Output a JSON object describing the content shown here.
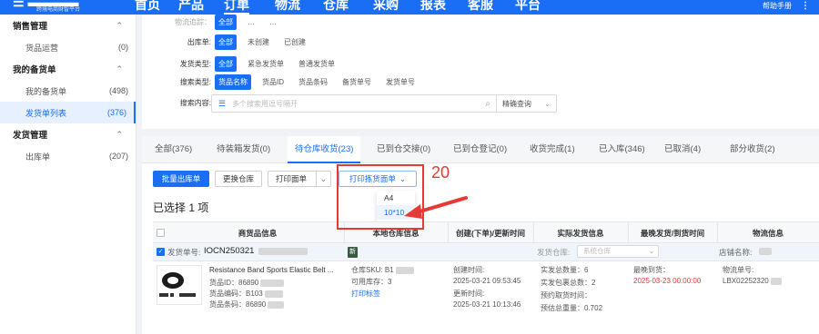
{
  "nav": {
    "logo": "",
    "logo_sub": "跨境电商财智平台",
    "items": [
      "首页",
      "产品",
      "订单",
      "物流",
      "仓库",
      "采购",
      "报表",
      "客服",
      "平台"
    ],
    "active_index": 2,
    "right_text": "帮助手册",
    "more_icon": "menu-dots-icon"
  },
  "sidebar": {
    "groups": [
      {
        "label": "销售管理",
        "items": [
          {
            "label": "货品运营",
            "count": "(0)"
          }
        ]
      },
      {
        "label": "我的备货单",
        "items": [
          {
            "label": "我的备货单",
            "count": "(498)"
          },
          {
            "label": "发货单列表",
            "count": "(376)",
            "active": true
          }
        ]
      },
      {
        "label": "发货管理",
        "items": [
          {
            "label": "出库单",
            "count": "(207)"
          }
        ]
      }
    ]
  },
  "filters": {
    "row0_label": "物流追踪：",
    "row0_chips": [
      "全部",
      "…",
      "…"
    ],
    "outbound_label": "出库单:",
    "outbound_chips": [
      "全部",
      "未创建",
      "已创建"
    ],
    "ship_type_label": "发货类型:",
    "ship_type_chips": [
      "全部",
      "紧急发货单",
      "普通发货单"
    ],
    "search_type_label": "搜索类型:",
    "search_type_chips": [
      "货品名称",
      "货品ID",
      "货品条码",
      "备货单号",
      "发货单号"
    ],
    "content_label": "搜索内容:",
    "search_placeholder": "多个搜索用逗号隔开",
    "search_mode": "精确查询"
  },
  "tabs": [
    {
      "label": "全部(376)"
    },
    {
      "label": "待装箱发货(0)"
    },
    {
      "label": "待仓库收货(23)",
      "active": true
    },
    {
      "label": "已到仓交接(0)"
    },
    {
      "label": "已到仓登记(0)"
    },
    {
      "label": "收货完成(1)"
    },
    {
      "label": "已入库(346)"
    },
    {
      "label": "已取消(4)"
    },
    {
      "label": "部分收货(2)"
    }
  ],
  "toolbar": {
    "batch_outbound": "批量出库单",
    "change_warehouse": "更换仓库",
    "print_sheet": "打印面单",
    "print_pick": "打印拣货面单"
  },
  "dropdown": {
    "options": [
      "A4",
      "10*10"
    ],
    "highlighted": 1
  },
  "annotation": {
    "number": "20",
    "color": "#e53935"
  },
  "selected_text": "已选择 1 项",
  "table": {
    "headers": [
      "商货品信息",
      "本地仓库信息",
      "创建(下单)/更新时间",
      "实际发货信息",
      "最晚发货/到货时间",
      "物流信息"
    ],
    "order_row": {
      "order_label": "发货单号:",
      "order_no": "IOCN250321",
      "badge": "新",
      "warehouse_label": "发货仓库:",
      "warehouse_placeholder": "系统仓库",
      "store_label": "店铺名称:"
    },
    "item": {
      "title": "Resistance Band Sports Elastic Belt ...",
      "id_label": "货品ID：",
      "id_value": "86890",
      "code_label": "货品编码：",
      "code_value": "B103",
      "barcode_label": "货品条码：",
      "barcode_value": "86890",
      "sku_label": "仓库SKU:",
      "sku_value": "B1",
      "stock_label": "可用库存：",
      "stock_value": "3",
      "print_label": "打印标签",
      "created_label": "创建时间:",
      "created_value": "2025-03-21 09:53:45",
      "updated_label": "更新时间:",
      "updated_value": "2025-03-21 10:13:46",
      "ship_qty": "实发总数量：6",
      "ship_packages": "实发包裹总数：2",
      "est_time": "预约取货时间：",
      "est_weight": "预估总重量：0.702",
      "latest_label": "最晚到货：",
      "latest_value": "2025-03-23 00:00:00",
      "logistics_label": "物流单号:",
      "logistics_value": "LBX02252320"
    }
  }
}
